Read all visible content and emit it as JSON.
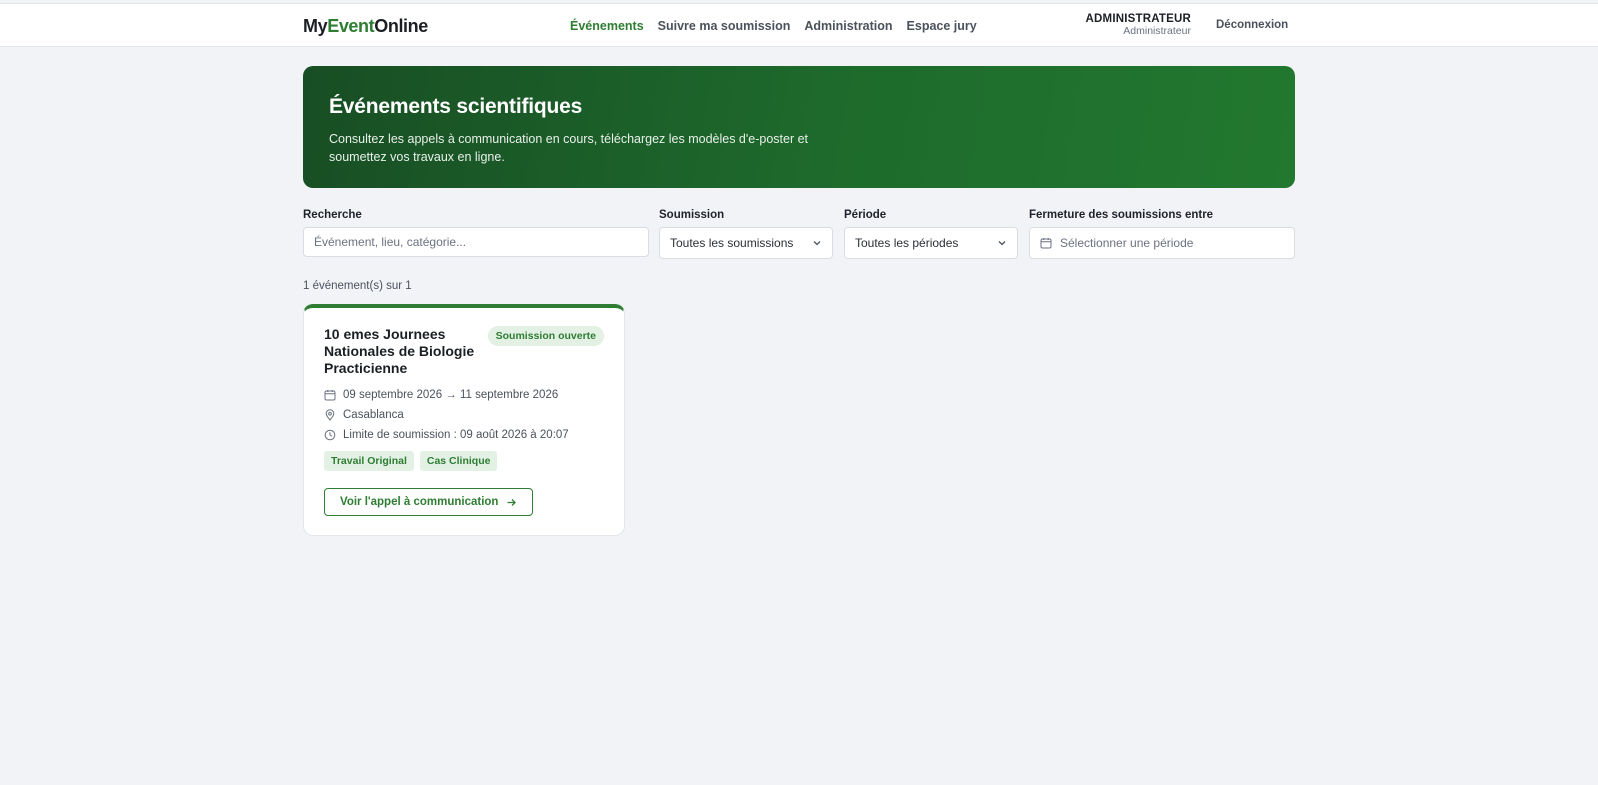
{
  "header": {
    "logo_prefix": "My",
    "logo_accent": "Event",
    "logo_suffix": "Online",
    "nav": [
      {
        "label": "Événements",
        "active": true
      },
      {
        "label": "Suivre ma soumission"
      },
      {
        "label": "Administration"
      },
      {
        "label": "Espace jury"
      }
    ],
    "user_name": "ADMINISTRATEUR",
    "user_role": "Administrateur",
    "logout_label": "Déconnexion"
  },
  "hero": {
    "title": "Événements scientifiques",
    "subtitle": "Consultez les appels à communication en cours, téléchargez les modèles d'e-poster et soumettez vos travaux en ligne."
  },
  "filters": {
    "search_label": "Recherche",
    "search_placeholder": "Événement, lieu, catégorie...",
    "submission_label": "Soumission",
    "submission_value": "Toutes les soumissions",
    "period_label": "Période",
    "period_value": "Toutes les périodes",
    "closing_label": "Fermeture des soumissions entre",
    "closing_placeholder": "Sélectionner une période"
  },
  "results_count": "1 événement(s) sur 1",
  "events": [
    {
      "title": "10 emes Journees Nationales de Biologie Practicienne",
      "status": "Soumission ouverte",
      "dates": "09 septembre 2026 → 11 septembre 2026",
      "location": "Casablanca",
      "deadline": "Limite de soumission : 09 août 2026 à 20:07",
      "tags": [
        "Travail Original",
        "Cas Clinique"
      ],
      "cta": "Voir l'appel à communication"
    }
  ],
  "colors": {
    "accent": "#2e7d32",
    "hero_start": "#184e24",
    "hero_end": "#22782f",
    "background": "#f1f3f6"
  },
  "icons": [
    "calendar-icon",
    "map-pin-icon",
    "clock-icon",
    "arrow-right-icon",
    "chevron-down-icon"
  ]
}
